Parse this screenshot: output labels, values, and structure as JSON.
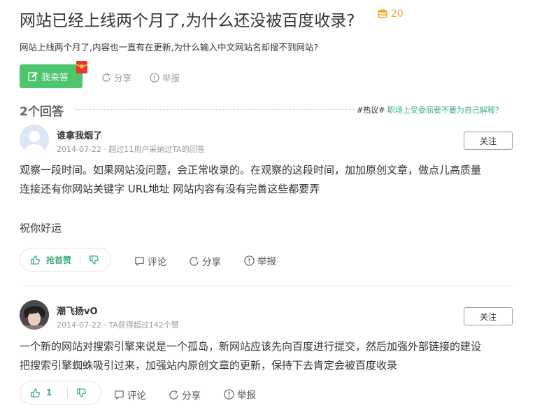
{
  "question": {
    "title": "网站已经上线两个月了,为什么还没被百度收录?",
    "reward": "20",
    "description": "网站上线两个月了,内容也一直有在更新,为什么输入中文网站名却搜不到网站?",
    "answer_button": "我来答",
    "share": "分享",
    "report": "举报"
  },
  "answers_header": {
    "count": "2个回答",
    "hot_tag": "#热议#",
    "hot_text": "职场上受委屈要不要为自己解释？"
  },
  "answers": [
    {
      "username": "谁拿我烟了",
      "date": "2014-07-22 · 超过11用户采纳过TA的回答",
      "follow": "关注",
      "line1": "观察一段时间。如果网站没问题，会正常收录的。在观察的这段时间，加加原创文章，做点儿高质量",
      "line2": "连接还有你网站关键字 URL地址 网站内容有没有完善这些都要弄",
      "line3": "祝你好运",
      "vote_label": "抢首赞",
      "comment": "评论",
      "share": "分享",
      "report": "举报"
    },
    {
      "username": "潮飞扬vO",
      "date": "2014-07-22 · TA获得超过142个赞",
      "follow": "关注",
      "line1": "一个新的网站对搜索引擎来说是一个孤岛，新网站应该先向百度进行提交，然后加强外部链接的建设",
      "line2": "把搜索引擎蜘蛛吸引过来，加强站内原创文章的更新，保持下去肯定会被百度收录",
      "vote_label": "1",
      "comment": "评论",
      "share": "分享",
      "report": "举报"
    }
  ],
  "colors": {
    "accent_green": "#4cc56d",
    "link_green": "#3eaf7c",
    "reward_gold": "#f5a623",
    "muted": "#999999"
  }
}
